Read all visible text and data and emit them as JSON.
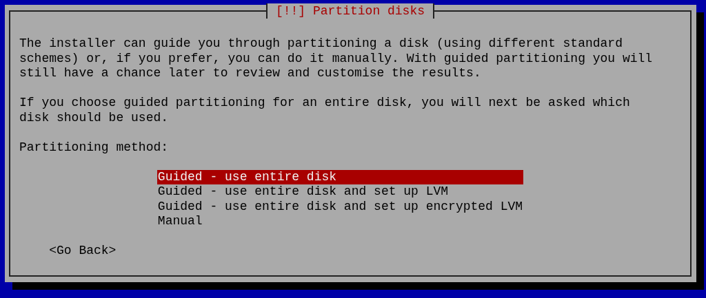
{
  "dialog": {
    "title": "[!!] Partition disks",
    "paragraphs": [
      "The installer can guide you through partitioning a disk (using different standard schemes) or, if you prefer, you can do it manually. With guided partitioning you will still have a chance later to review and customise the results.",
      "If you choose guided partitioning for an entire disk, you will next be asked which disk should be used."
    ],
    "prompt": "Partitioning method:",
    "options": [
      {
        "label": "Guided - use entire disk",
        "selected": true
      },
      {
        "label": "Guided - use entire disk and set up LVM",
        "selected": false
      },
      {
        "label": "Guided - use entire disk and set up encrypted LVM",
        "selected": false
      },
      {
        "label": "Manual",
        "selected": false
      }
    ],
    "buttons": [
      "<Go Back>"
    ]
  }
}
